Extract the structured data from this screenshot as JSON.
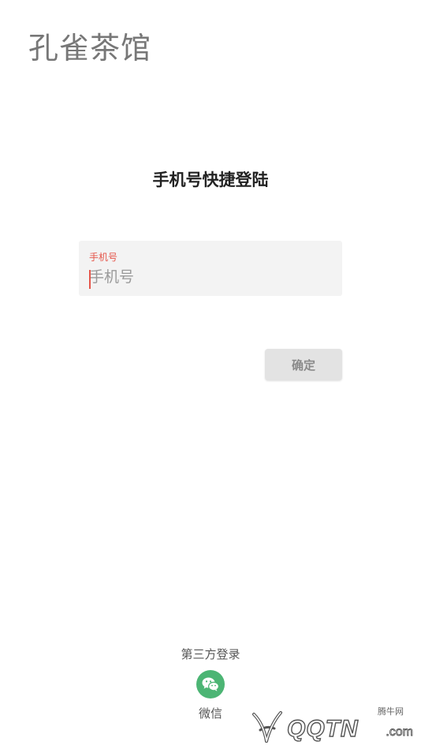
{
  "header": {
    "app_title": "孔雀茶馆"
  },
  "login": {
    "heading": "手机号快捷登陆",
    "phone_field": {
      "label": "手机号",
      "placeholder": "手机号",
      "value": ""
    },
    "confirm_label": "确定"
  },
  "third_party": {
    "title": "第三方登录",
    "wechat": {
      "label": "微信",
      "icon": "wechat-icon"
    }
  },
  "watermark": {
    "cn": "腾牛网",
    "en": "QQTN",
    "com": ".com"
  },
  "colors": {
    "accent": "#e5554a",
    "wechat_green": "#4cb574",
    "field_bg": "#f3f3f3",
    "button_bg": "#e3e3e3"
  }
}
